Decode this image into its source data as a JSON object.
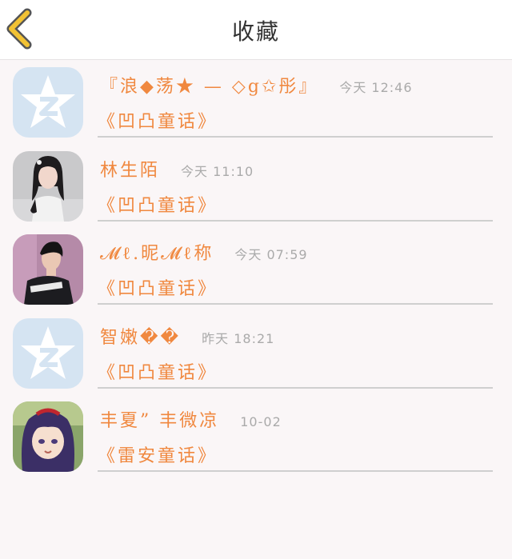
{
  "header": {
    "title": "收藏",
    "back_icon": "chevron-left-icon",
    "accent": "#f2c233"
  },
  "favorites": [
    {
      "avatar": "qzone-default",
      "name": "『浪◆荡★ — ◇g✩彤』",
      "time": "今天 12:46",
      "book": "《凹凸童话》"
    },
    {
      "avatar": "photo-girl",
      "name": "林生陌",
      "time": "今天 11:10",
      "book": "《凹凸童话》"
    },
    {
      "avatar": "photo-boy",
      "name": "𝓜ℓ.昵𝓜ℓ称",
      "time": "今天 07:59",
      "book": "《凹凸童话》"
    },
    {
      "avatar": "qzone-default",
      "name": "智嫩��",
      "time": "昨天 18:21",
      "book": "《凹凸童话》"
    },
    {
      "avatar": "anime-girl",
      "name": "丰夏” 丰微凉",
      "time": "10-02",
      "book": "《雷安童话》"
    }
  ],
  "colors": {
    "name_text": "#f0883f",
    "time_text": "#aaaaaa",
    "background": "#faf6f7"
  }
}
